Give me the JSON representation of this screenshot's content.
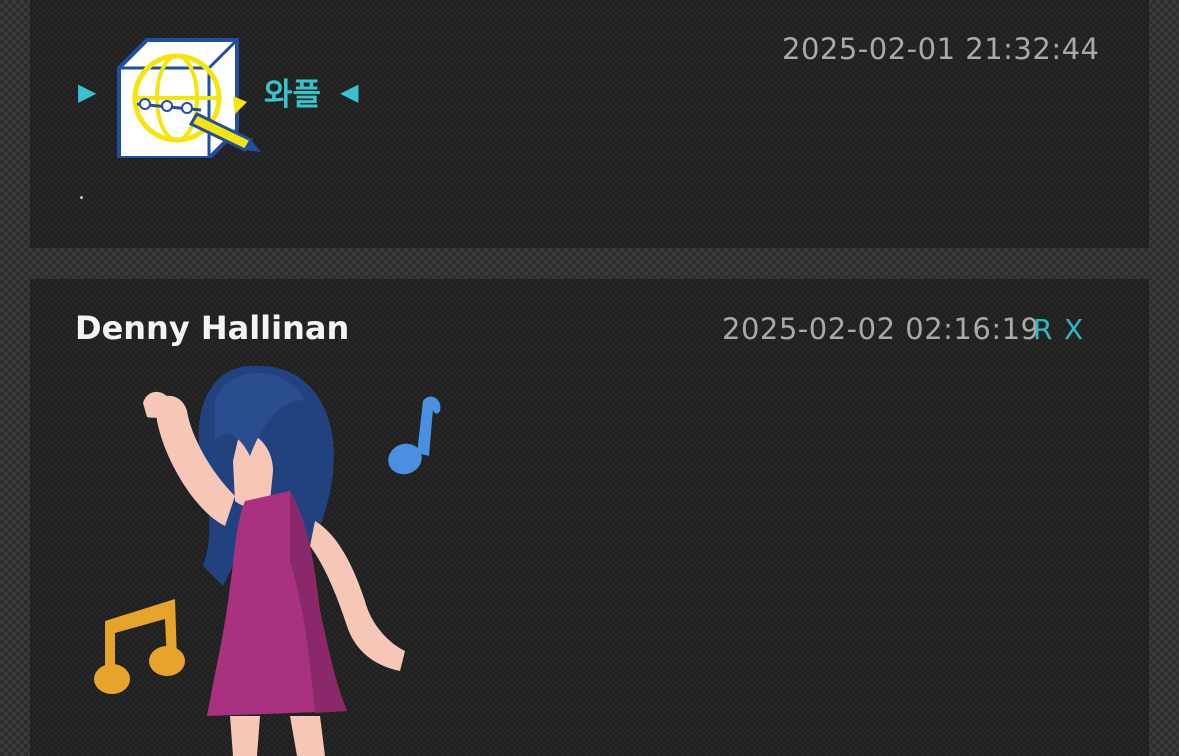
{
  "comments": [
    {
      "nickname": "와플",
      "nickname_prefix_icon": "play-right-icon",
      "nickname_suffix_icon": "play-left-icon",
      "nickname_image": "wireframe-cube-pencil-icon",
      "timestamp": "2025-02-01 21:32:44",
      "body": "."
    },
    {
      "author": "Denny Hallinan",
      "timestamp": "2025-02-02 02:16:19",
      "reply_label": "R",
      "delete_label": "X",
      "image": "dancing-woman-illustration"
    }
  ],
  "colors": {
    "accent": "#36c3cc",
    "timestamp": "#a9a9a9",
    "card_bg": "#202020",
    "page_bg": "#2e2e2e"
  }
}
